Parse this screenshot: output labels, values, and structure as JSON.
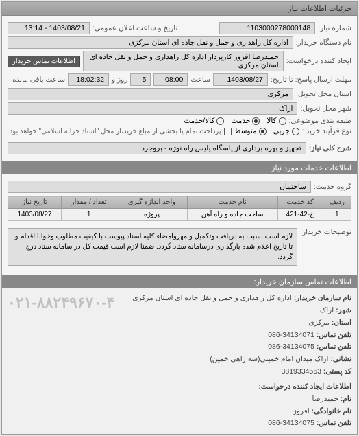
{
  "panel_title": "جزئیات اطلاعات نیاز",
  "fields": {
    "number_label": "شماره نیاز:",
    "number_value": "1103000278000148",
    "announce_label": "تاریخ و ساعت اعلان عمومی:",
    "announce_value": "1403/08/21 - 13:14",
    "buyer_org_label": "نام دستگاه خریدار:",
    "buyer_org_value": "اداره کل راهداری و حمل و نقل جاده ای استان مرکزی",
    "requester_label": "ایجاد کننده درخواست:",
    "requester_value": "حمیدرضا  افروز  کارپرداز اداره کل راهداری و حمل و نقل جاده ای استان مرکزی",
    "buyer_contact_btn": "اطلاعات تماس خریدار",
    "deadline_label": "مهلت ارسال پاسخ: تا تاریخ:",
    "deadline_date": "1403/08/27",
    "time_label": "ساعت",
    "deadline_time": "08:00",
    "days_label": "روز و",
    "days_value": "5",
    "remain_time": "18:02:32",
    "remain_label": "ساعت باقی مانده",
    "province_label": "استان محل تحویل:",
    "province_value": "مرکزی",
    "city_label": "شهر محل تحویل:",
    "city_value": "اراک",
    "budget_label": "طبقه بندی موضوعی:",
    "budget_kala": "کالا",
    "budget_khadamat": "خدمت",
    "budget_both": "کالا/خدمت",
    "purchase_type_label": "نوع فرآیند خرید :",
    "pt_small": "جزیی",
    "pt_medium": "متوسط",
    "purchase_note": "پرداخت تمام یا بخشی از مبلغ خرید،از محل \"اسناد خزانه اسلامی\" خواهد بود.",
    "subject_label": "شرح کلی نیاز:",
    "subject_value": "تجهیز و بهره برداری از پاسگاه پلیس راه نوژه - بروجرد"
  },
  "services_header": "اطلاعات خدمات مورد نیاز",
  "service_group_label": "گروه خدمت:",
  "service_group_value": "ساختمان",
  "table": {
    "headers": [
      "ردیف",
      "کد خدمت",
      "نام خدمت",
      "واحد اندازه گیری",
      "تعداد / مقدار",
      "تاریخ نیاز"
    ],
    "row": [
      "1",
      "خ-42-421",
      "ساخت جاده و راه آهن",
      "پروژه",
      "1",
      "1403/08/27"
    ]
  },
  "buyer_note_label": "توضیحات خریدار:",
  "buyer_note": "لازم است نسبت به دریافت وتکمیل و مهروامضاء کلیه اسناد پیوست با کیفیت مطلوب وخوانا اقدام و تا تاریخ اعلام شده بارگذاری درسامانه ستاد گردد. ضمنا لازم است قیمت کل در سامانه ستاد درج گردد.",
  "contact_header": "اطلاعات تماس سازمان خریدار:",
  "contact": {
    "org_label": "نام سازمان  خریدار:",
    "org_value": "اداره کل راهداری و حمل و نقل جاده ای استان مرکزی",
    "city_label": "شهر:",
    "city_value": "اراک",
    "province_label": "استان:",
    "province_value": "مرکزی",
    "phone_label": "تلفن تماس:",
    "phone_value": "34134071-086",
    "fax_label": "تلفن تماس:",
    "fax_value": "34134075-086",
    "address_label": "نشانی:",
    "address_value": "اراک میدان امام خمینی(سه راهی خمین)",
    "post_label": "کد پستی:",
    "post_value": "3819334553",
    "creator_header": "اطلاعات ایجاد کننده درخواست:",
    "fname_label": "نام:",
    "fname_value": "حمیدرضا",
    "lname_label": "نام خانوادگی:",
    "lname_value": "افروز",
    "cphone_label": "تلفن تماس:",
    "cphone_value": "34134075-086",
    "big_phone": "۰۲۱-۸۸۲۴۹۶۷۰-۴"
  }
}
